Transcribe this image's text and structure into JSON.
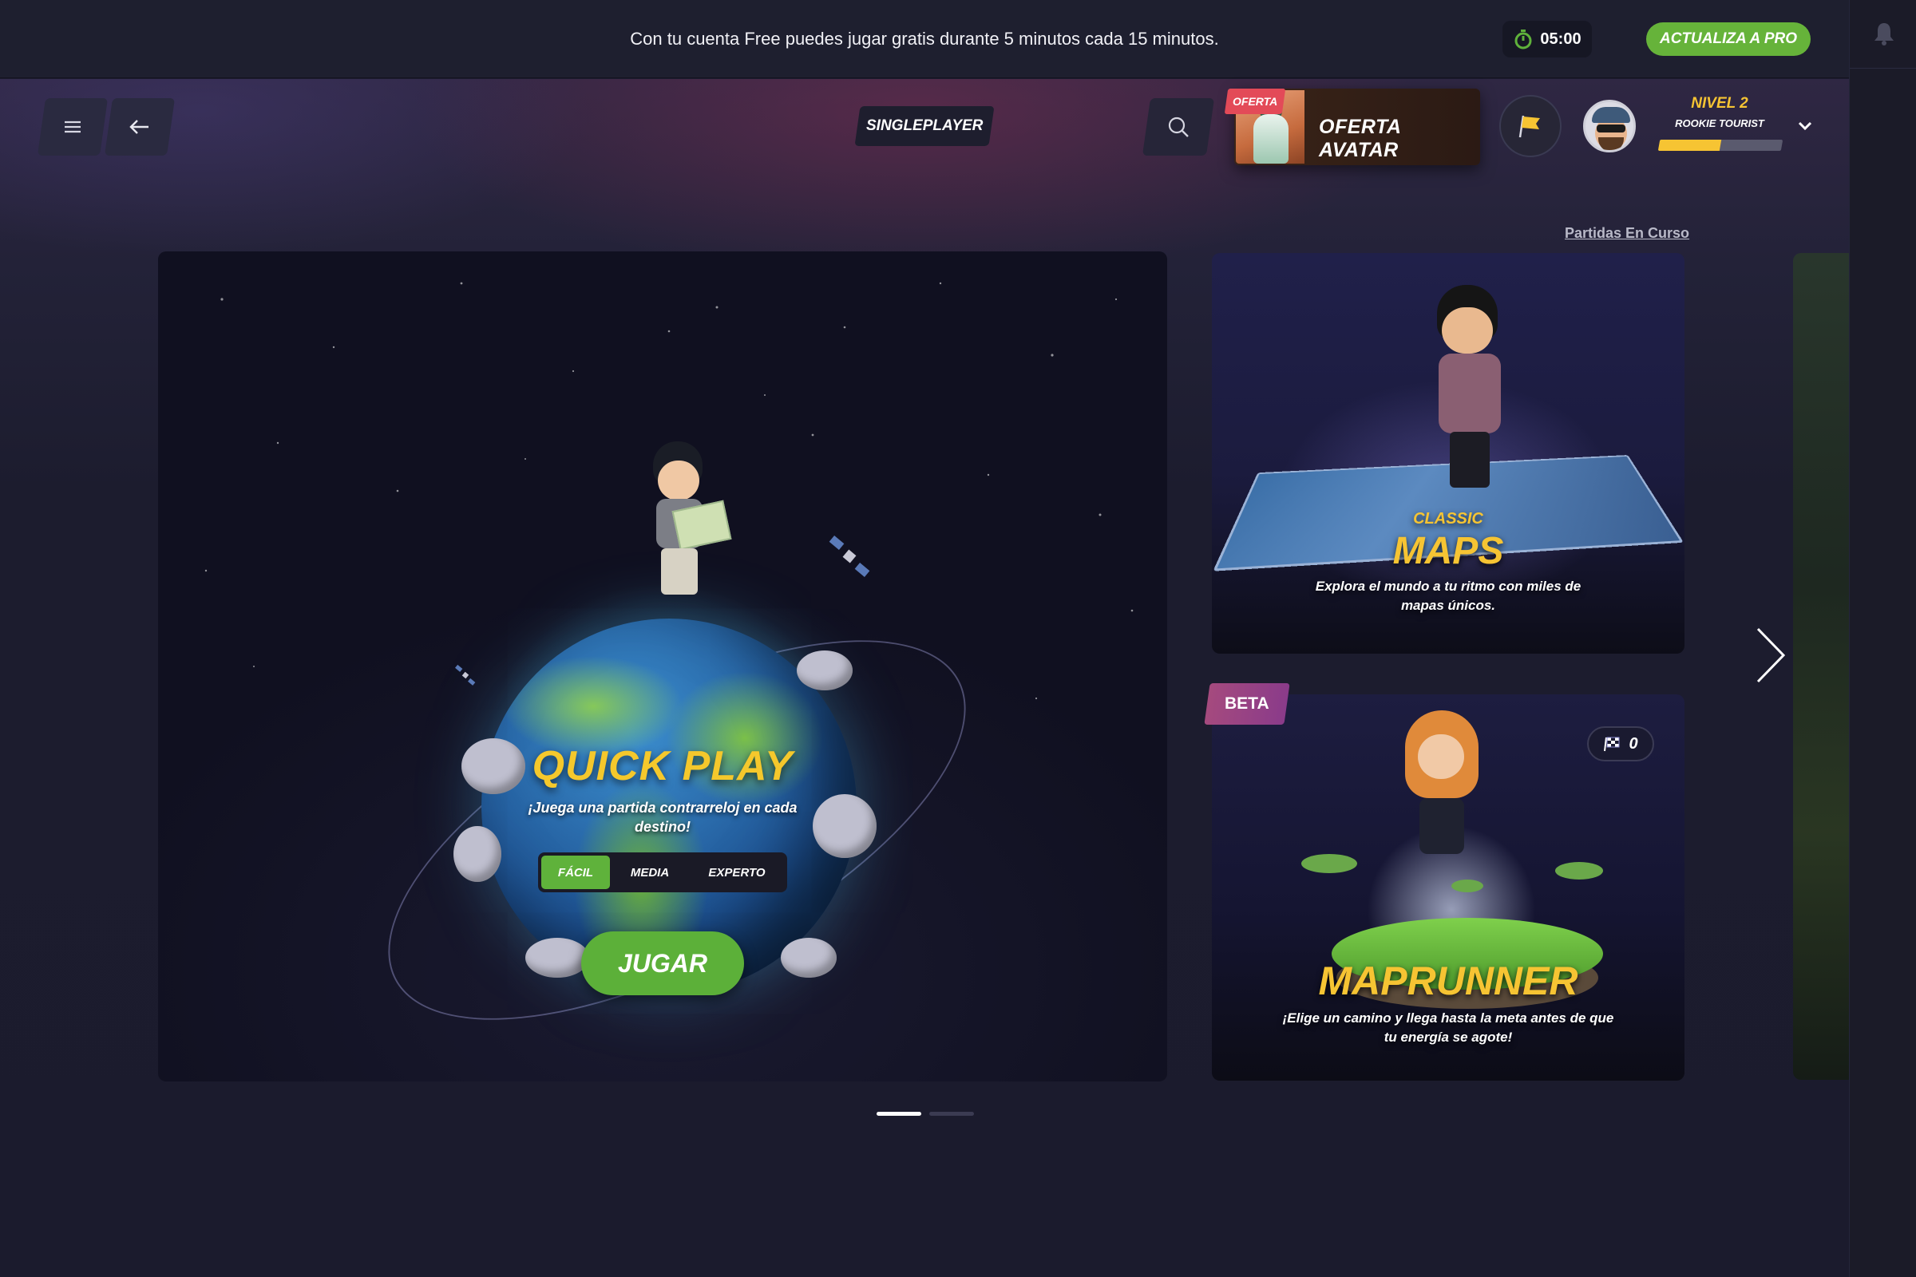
{
  "banner": {
    "message": "Con tu cuenta Free puedes jugar gratis durante 5 minutos cada 15 minutos.",
    "timer": "05:00",
    "upgrade_label": "ACTUALIZA A PRO"
  },
  "header": {
    "mode_label": "SINGLEPLAYER",
    "offer": {
      "tag": "OFERTA",
      "title": "OFERTA AVATAR"
    },
    "user": {
      "level": "NIVEL 2",
      "rank": "ROOKIE TOURIST",
      "level_progress": 0.5
    }
  },
  "ongoing_link": "Partidas En Curso",
  "quick_play": {
    "title": "QUICK PLAY",
    "subtitle": "¡Juega una partida contrarreloj en cada destino!",
    "difficulties": [
      "FÁCIL",
      "MEDIA",
      "EXPERTO"
    ],
    "selected_difficulty": "FÁCIL",
    "play_label": "JUGAR"
  },
  "classic_maps": {
    "kicker": "CLASSIC",
    "title": "MAPS",
    "description": "Explora el mundo a tu ritmo con miles de mapas únicos."
  },
  "maprunner": {
    "tag": "BETA",
    "counter": "0",
    "title": "MAPRUNNER",
    "description": "¡Elige un camino y llega hasta la meta antes de que tu energía se agote!"
  },
  "carousel": {
    "pages": 2,
    "current": 1
  },
  "colors": {
    "accent_green": "#5fb23b",
    "accent_yellow": "#f6c433",
    "offer_red": "#e34a58",
    "beta_purple": "#a54a7e"
  }
}
